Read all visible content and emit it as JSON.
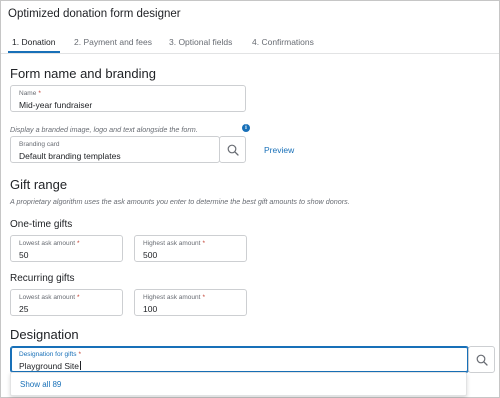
{
  "window": {
    "title": "Optimized donation form designer"
  },
  "tabs": [
    {
      "label": "1. Donation",
      "active": true
    },
    {
      "label": "2. Payment and fees",
      "active": false
    },
    {
      "label": "3. Optional fields",
      "active": false
    },
    {
      "label": "4. Confirmations",
      "active": false
    }
  ],
  "branding": {
    "heading": "Form name and branding",
    "name_label": "Name",
    "name_value": "Mid-year fundraiser",
    "help": "Display a branded image, logo and text alongside the form.",
    "card_label": "Branding card",
    "card_value": "Default branding templates",
    "preview": "Preview"
  },
  "gift_range": {
    "heading": "Gift range",
    "help": "A proprietary algorithm uses the ask amounts you enter to determine the best gift amounts to show donors.",
    "one_time": {
      "heading": "One-time gifts",
      "lowest_label": "Lowest ask amount",
      "lowest_value": "50",
      "highest_label": "Highest ask amount",
      "highest_value": "500"
    },
    "recurring": {
      "heading": "Recurring gifts",
      "lowest_label": "Lowest ask amount",
      "lowest_value": "25",
      "highest_label": "Highest ask amount",
      "highest_value": "100"
    }
  },
  "designation": {
    "heading": "Designation",
    "field_label": "Designation for gifts",
    "field_value": "Playground Site",
    "dropdown_link": "Show all 89"
  },
  "required_marker": "*",
  "info_glyph": "i",
  "colors": {
    "accent": "#1870b8",
    "required": "#c0392b",
    "text": "#212327",
    "muted": "#686c73"
  },
  "icons": {
    "search": "search-icon",
    "info": "info-icon"
  }
}
